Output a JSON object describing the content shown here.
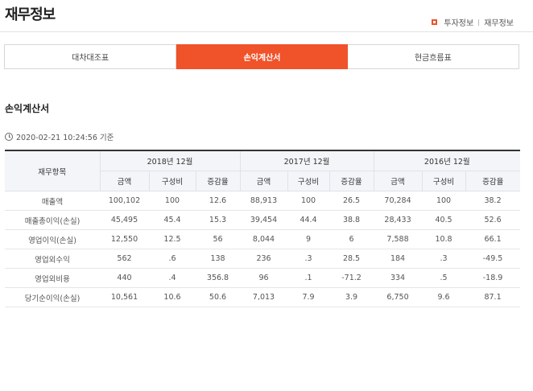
{
  "header": {
    "title": "재무정보",
    "breadcrumb": [
      "투자정보",
      "재무정보"
    ]
  },
  "tabs": [
    {
      "label": "대차대조표",
      "active": false
    },
    {
      "label": "손익계산서",
      "active": true
    },
    {
      "label": "현금흐름표",
      "active": false
    }
  ],
  "section": {
    "title": "손익계산서",
    "timestamp": "2020-02-21 10:24:56 기준"
  },
  "table": {
    "item_header": "재무항목",
    "periods": [
      "2018년 12월",
      "2017년 12월",
      "2016년 12월"
    ],
    "sub_headers": [
      "금액",
      "구성비",
      "증감율"
    ],
    "rows": [
      {
        "item": "매출액",
        "values": [
          "100,102",
          "100",
          "12.6",
          "88,913",
          "100",
          "26.5",
          "70,284",
          "100",
          "38.2"
        ]
      },
      {
        "item": "매출총이익(손실)",
        "values": [
          "45,495",
          "45.4",
          "15.3",
          "39,454",
          "44.4",
          "38.8",
          "28,433",
          "40.5",
          "52.6"
        ]
      },
      {
        "item": "영업이익(손실)",
        "values": [
          "12,550",
          "12.5",
          "56",
          "8,044",
          "9",
          "6",
          "7,588",
          "10.8",
          "66.1"
        ]
      },
      {
        "item": "영업외수익",
        "values": [
          "562",
          ".6",
          "138",
          "236",
          ".3",
          "28.5",
          "184",
          ".3",
          "-49.5"
        ]
      },
      {
        "item": "영업외비용",
        "values": [
          "440",
          ".4",
          "356.8",
          "96",
          ".1",
          "-71.2",
          "334",
          ".5",
          "-18.9"
        ]
      },
      {
        "item": "당기순이익(손실)",
        "values": [
          "10,561",
          "10.6",
          "50.6",
          "7,013",
          "7.9",
          "3.9",
          "6,750",
          "9.6",
          "87.1"
        ]
      }
    ]
  },
  "colors": {
    "accent": "#f0522a",
    "header_bg": "#f3f5f9"
  }
}
